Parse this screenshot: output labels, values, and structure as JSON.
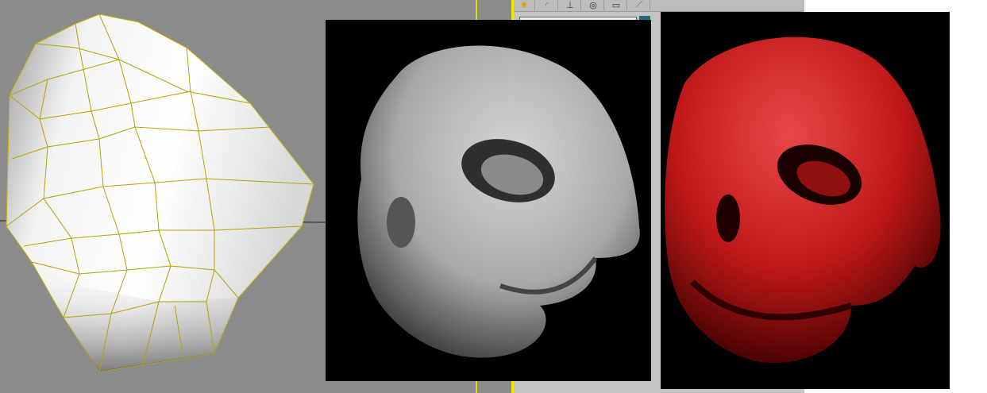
{
  "window": {
    "title": ""
  },
  "toolbar": {
    "icons": [
      "create-light-icon",
      "modify-curve-icon",
      "hierarchy-icon",
      "motion-icon",
      "display-icon",
      "utilities-hammer-icon"
    ]
  },
  "colors": {
    "viewport": "#8b8b8b",
    "wire": "#c8b400",
    "panel": "#c4c4c4",
    "accent_swatch": "#1f6b7d",
    "red_material": "#c01818"
  }
}
